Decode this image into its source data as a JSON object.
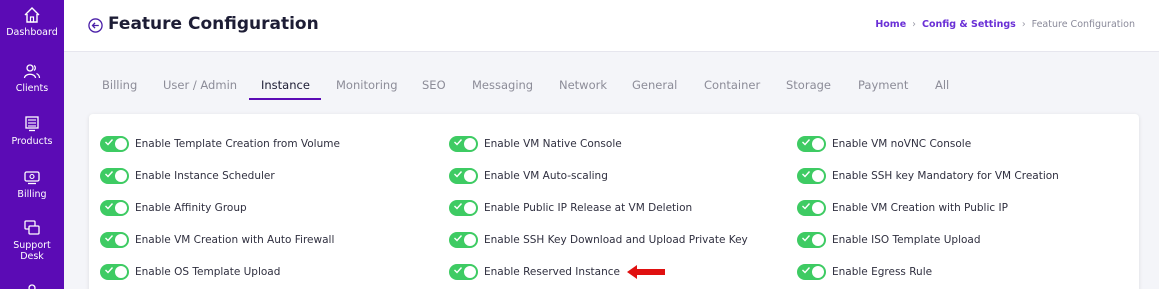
{
  "sidebar": {
    "items": [
      {
        "label": "Dashboard",
        "icon": "home-icon"
      },
      {
        "label": "Clients",
        "icon": "users-icon"
      },
      {
        "label": "Products",
        "icon": "server-icon"
      },
      {
        "label": "Billing",
        "icon": "billing-icon"
      },
      {
        "label": "Support Desk",
        "icon": "support-icon"
      }
    ]
  },
  "header": {
    "title": "Feature Configuration",
    "breadcrumb": [
      "Home",
      "Config & Settings",
      "Feature Configuration"
    ]
  },
  "tabs": [
    "Billing",
    "User / Admin",
    "Instance",
    "Monitoring",
    "SEO",
    "Messaging",
    "Network",
    "General",
    "Container",
    "Storage",
    "Payment",
    "All"
  ],
  "active_tab": "Instance",
  "features": {
    "columns": [
      [
        "Enable Template Creation from Volume",
        "Enable Instance Scheduler",
        "Enable Affinity Group",
        "Enable VM Creation with Auto Firewall",
        "Enable OS Template Upload"
      ],
      [
        "Enable VM Native Console",
        "Enable VM Auto-scaling",
        "Enable Public IP Release at VM Deletion",
        "Enable SSH Key Download and Upload Private Key",
        "Enable Reserved Instance"
      ],
      [
        "Enable VM noVNC Console",
        "Enable SSH key Mandatory for VM Creation",
        "Enable VM Creation with Public IP",
        "Enable ISO Template Upload",
        "Enable Egress Rule"
      ]
    ]
  },
  "colors": {
    "sidebar": "#5b0bb5",
    "toggle_on": "#3ecb63",
    "accent": "#6a2fd6",
    "arrow": "#e01010"
  }
}
